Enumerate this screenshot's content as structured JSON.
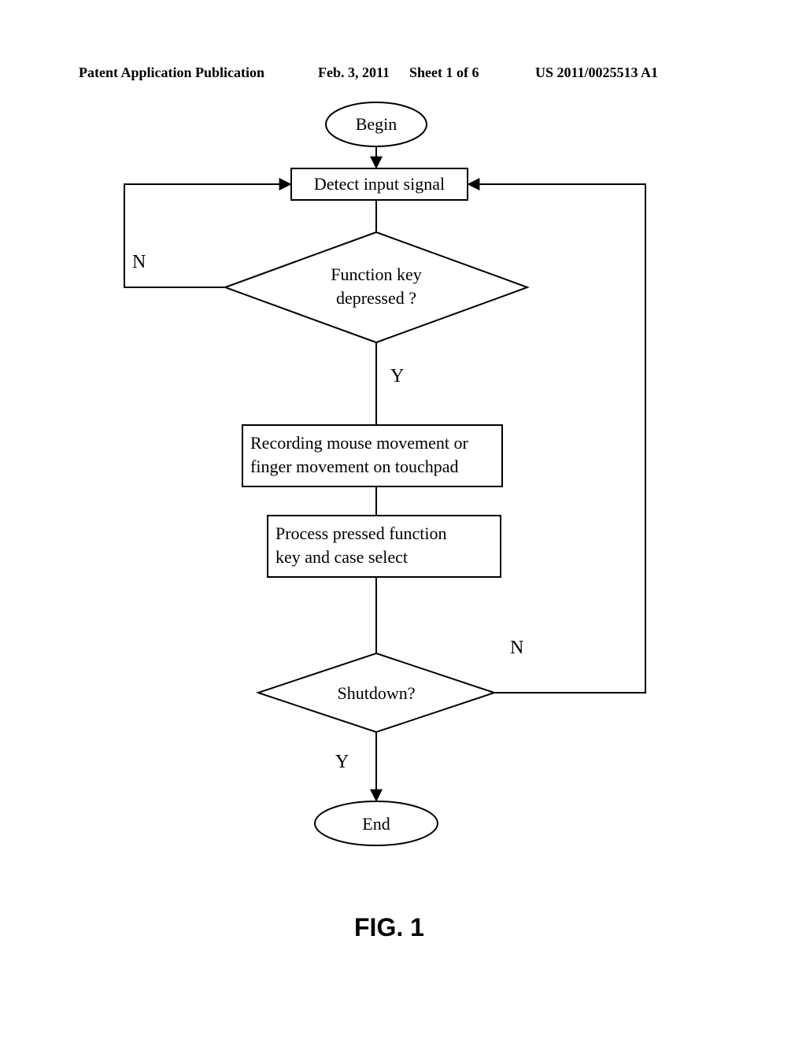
{
  "header": {
    "left": "Patent Application Publication",
    "center": "Feb. 3, 2011",
    "sheet": "Sheet 1 of 6",
    "right": "US 2011/0025513 A1"
  },
  "figure_label": "FIG. 1",
  "flow": {
    "begin": "Begin",
    "detect": "Detect input signal",
    "decision1_l1": "Function key",
    "decision1_l2": "depressed ?",
    "record_l1": "Recording mouse movement or",
    "record_l2": "finger movement on touchpad",
    "process_l1": "Process  pressed  function",
    "process_l2": "key and case select",
    "decision2": "Shutdown?",
    "end": "End",
    "yes": "Y",
    "no": "N"
  }
}
